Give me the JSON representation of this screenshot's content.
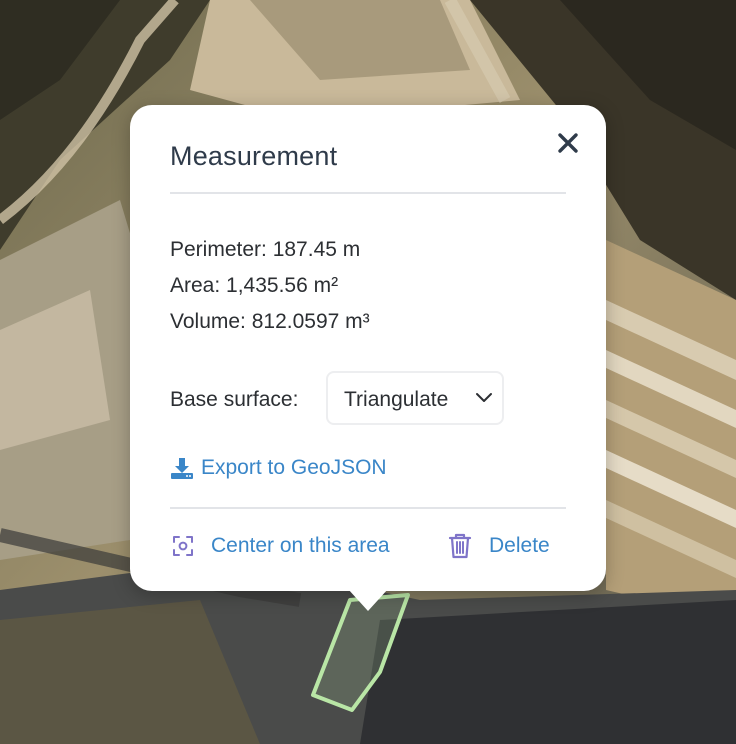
{
  "popup": {
    "title": "Measurement",
    "close_icon": "close-icon",
    "metrics": {
      "perimeter": "Perimeter: 187.45 m",
      "area": "Area: 1,435.56 m²",
      "volume": "Volume: 812.0597 m³"
    },
    "base_surface": {
      "label": "Base surface:",
      "selected": "Triangulate"
    },
    "export_label": "Export to GeoJSON",
    "center_label": "Center on this area",
    "delete_label": "Delete"
  },
  "colors": {
    "link": "#3a86c8",
    "polygon_outline": "#b9e6a6",
    "icon_purple": "#7f74c9"
  }
}
